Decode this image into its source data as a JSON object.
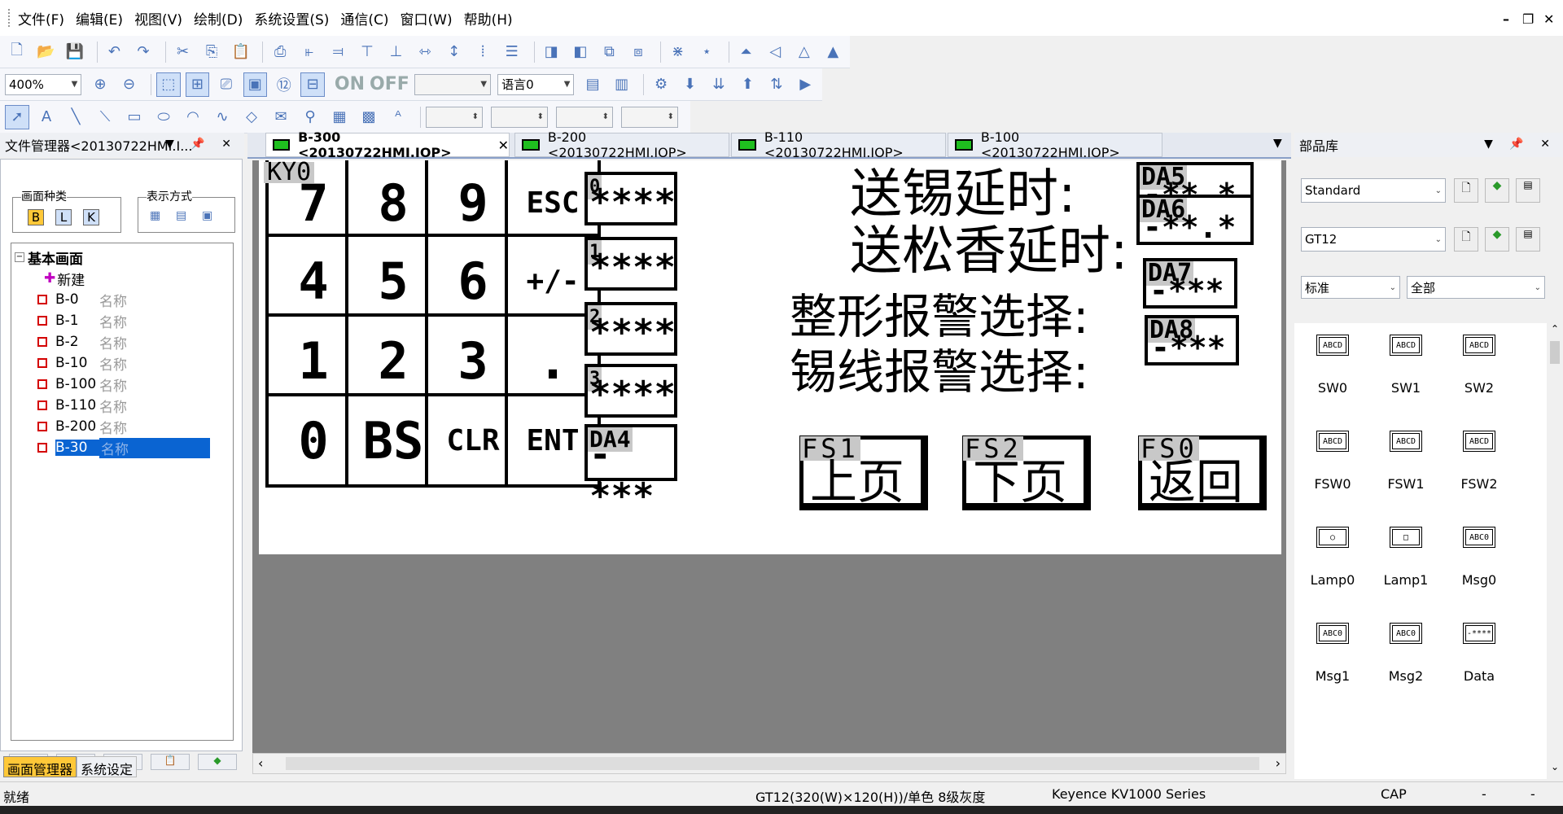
{
  "menu": [
    "文件(F)",
    "编辑(E)",
    "视图(V)",
    "绘制(D)",
    "系统设置(S)",
    "通信(C)",
    "窗口(W)",
    "帮助(H)"
  ],
  "window_buttons": {
    "minimize": "–",
    "restore": "❐",
    "close": "✕"
  },
  "toolbar2": {
    "zoom": "400%",
    "onoff_on": "ON",
    "onoff_off": "OFF",
    "language": "语言0"
  },
  "file_manager": {
    "title": "文件管理器<20130722HMI.I...",
    "screen_type_label": "画面种类",
    "screen_type_buttons": [
      "B",
      "L",
      "K"
    ],
    "display_mode_label": "表示方式",
    "root": "基本画面",
    "new_item": "新建",
    "items": [
      {
        "code": "B-0",
        "name": "名称"
      },
      {
        "code": "B-1",
        "name": "名称"
      },
      {
        "code": "B-2",
        "name": "名称"
      },
      {
        "code": "B-10",
        "name": "名称"
      },
      {
        "code": "B-100",
        "name": "名称"
      },
      {
        "code": "B-110",
        "name": "名称"
      },
      {
        "code": "B-200",
        "name": "名称"
      },
      {
        "code": "B-30",
        "name": "名称"
      }
    ],
    "bottom_tabs": [
      "画面管理器",
      "系统设定"
    ]
  },
  "doc_tabs": [
    {
      "label": "B-300 <20130722HMI.IOP>",
      "active": true
    },
    {
      "label": "B-200 <20130722HMI.IOP>",
      "active": false
    },
    {
      "label": "B-110 <20130722HMI.IOP>",
      "active": false
    },
    {
      "label": "B-100 <20130722HMI.IOP>",
      "active": false
    }
  ],
  "canvas": {
    "keypad_tag": "KY0",
    "keys": [
      "7",
      "8",
      "9",
      "ESC",
      "4",
      "5",
      "6",
      "+/-",
      "1",
      "2",
      "3",
      ".",
      "0",
      "BS",
      "CLR",
      "ENT"
    ],
    "entry_fields": [
      {
        "tag": "0",
        "value": "****"
      },
      {
        "tag": "1",
        "value": "****"
      },
      {
        "tag": "2",
        "value": "****"
      },
      {
        "tag": "3",
        "value": "****"
      },
      {
        "tag": "DA4",
        "value": "-***"
      }
    ],
    "rows": [
      {
        "label": "送锡延时:",
        "tag": "DA5",
        "value": "-**.*"
      },
      {
        "label": "送松香延时:",
        "tag": "DA6",
        "value": "-**.*"
      },
      {
        "label": "整形报警选择:",
        "tag": "DA7",
        "value": "-***"
      },
      {
        "label": "锡线报警选择:",
        "tag": "DA8",
        "value": "-***"
      }
    ],
    "func_buttons": [
      {
        "tag": "FS1",
        "label": "上页"
      },
      {
        "tag": "FS2",
        "label": "下页"
      },
      {
        "tag": "FS0",
        "label": "返回"
      }
    ]
  },
  "parts_library": {
    "title": "部品库",
    "style_select": "Standard",
    "model_select": "GT12",
    "category_select": "标准",
    "filter_select": "全部",
    "parts": [
      {
        "icon": "ABCD",
        "label": "SW0"
      },
      {
        "icon": "ABCD",
        "label": "SW1"
      },
      {
        "icon": "ABCD",
        "label": "SW2"
      },
      {
        "icon": "ABCD",
        "label": "FSW0"
      },
      {
        "icon": "ABCD",
        "label": "FSW1"
      },
      {
        "icon": "ABCD",
        "label": "FSW2"
      },
      {
        "icon": "○",
        "label": "Lamp0"
      },
      {
        "icon": "□",
        "label": "Lamp1"
      },
      {
        "icon": "ABC0",
        "label": "Msg0"
      },
      {
        "icon": "ABC0",
        "label": "Msg1"
      },
      {
        "icon": "ABC0",
        "label": "Msg2"
      },
      {
        "icon": "-****",
        "label": "Data"
      }
    ]
  },
  "status": {
    "ready": "就绪",
    "device": "GT12(320(W)×120(H))/单色 8级灰度",
    "plc": "Keyence KV1000 Series",
    "cap": "CAP",
    "dash1": "-",
    "dash2": "-"
  }
}
